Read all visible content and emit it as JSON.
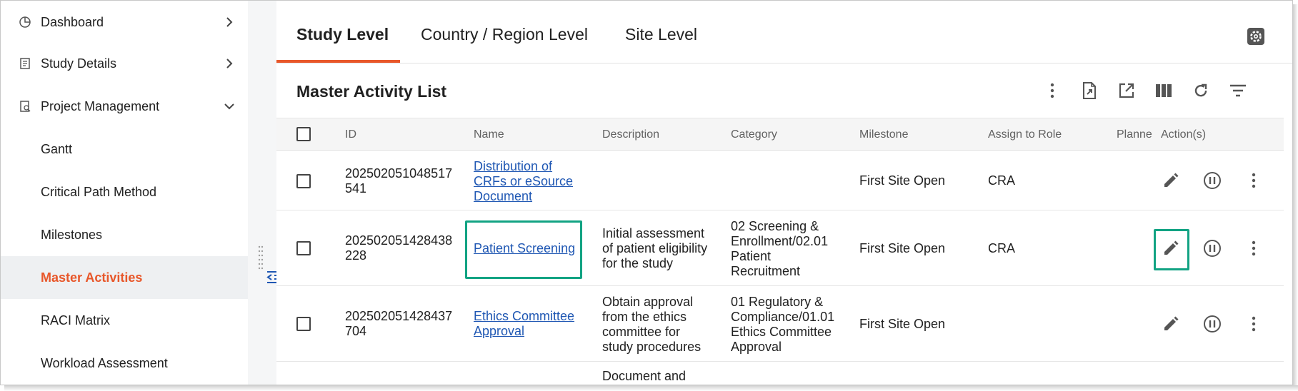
{
  "sidebar": {
    "items": [
      {
        "label": "Dashboard",
        "icon": "pie-chart-icon",
        "expanded": false
      },
      {
        "label": "Study Details",
        "icon": "document-icon",
        "expanded": false
      },
      {
        "label": "Project Management",
        "icon": "document-search-icon",
        "expanded": true
      }
    ],
    "sub_items": [
      {
        "label": "Gantt"
      },
      {
        "label": "Critical Path Method"
      },
      {
        "label": "Milestones"
      },
      {
        "label": "Master Activities",
        "active": true
      },
      {
        "label": "RACI Matrix"
      },
      {
        "label": "Workload Assessment"
      }
    ]
  },
  "tabs": [
    {
      "label": "Study Level",
      "active": true
    },
    {
      "label": "Country / Region Level"
    },
    {
      "label": "Site Level"
    }
  ],
  "list": {
    "title": "Master Activity List",
    "toolbar_icons": [
      "more-vertical-icon",
      "export-file-icon",
      "open-external-icon",
      "columns-icon",
      "refresh-icon",
      "filter-icon"
    ]
  },
  "table": {
    "columns": [
      "ID",
      "Name",
      "Description",
      "Category",
      "Milestone",
      "Assign to Role",
      "Planne",
      "Action(s)"
    ],
    "rows": [
      {
        "id_lines": [
          "202502051048517",
          "541"
        ],
        "name_lines": [
          "Distribution of",
          "CRFs or eSource",
          "Document"
        ],
        "desc_lines": [],
        "cat_lines": [],
        "milestone": "First Site Open",
        "role": "CRA"
      },
      {
        "id_lines": [
          "202502051428438",
          "228"
        ],
        "name_lines": [
          "Patient Screening"
        ],
        "desc_lines": [
          "Initial assessment",
          "of patient eligibility",
          "for the study"
        ],
        "cat_lines": [
          "02 Screening &",
          "Enrollment/02.01",
          "Patient",
          "Recruitment"
        ],
        "milestone": "First Site Open",
        "role": "CRA"
      },
      {
        "id_lines": [
          "202502051428437",
          "704"
        ],
        "name_lines": [
          "Ethics Committee",
          "Approval"
        ],
        "desc_lines": [
          "Obtain approval",
          "from the ethics",
          "committee for",
          "study procedures"
        ],
        "cat_lines": [
          "01 Regulatory &",
          "Compliance/01.01",
          "Ethics Committee",
          "Approval"
        ],
        "milestone": "First Site Open",
        "role": ""
      },
      {
        "id_lines": [],
        "name_lines": [],
        "desc_lines": [
          "Document and"
        ],
        "cat_lines": [],
        "milestone": "",
        "role": ""
      }
    ]
  },
  "colors": {
    "accent": "#e8572a",
    "link": "#1f57b3",
    "highlight": "#12a383"
  }
}
